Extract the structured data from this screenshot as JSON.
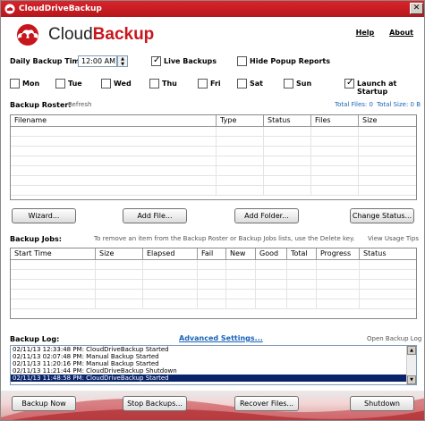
{
  "window": {
    "title": "CloudDriveBackup",
    "close_glyph": "✕"
  },
  "logo": {
    "prefix": "Cloud",
    "suffix": "Backup",
    "icon": "cloud-logo-icon"
  },
  "top_links": {
    "help": "Help",
    "about": "About"
  },
  "schedule": {
    "daily_label": "Daily Backup Time:",
    "time_value": "12:00 AM",
    "live_backups": {
      "label": "Live Backups",
      "checked": true
    },
    "hide_popup": {
      "label": "Hide Popup Reports",
      "checked": false
    },
    "launch_startup": {
      "label": "Launch at Startup",
      "checked": true
    },
    "days": [
      {
        "label": "Mon",
        "checked": false
      },
      {
        "label": "Tue",
        "checked": false
      },
      {
        "label": "Wed",
        "checked": false
      },
      {
        "label": "Thu",
        "checked": false
      },
      {
        "label": "Fri",
        "checked": false
      },
      {
        "label": "Sat",
        "checked": false
      },
      {
        "label": "Sun",
        "checked": false
      }
    ]
  },
  "roster": {
    "label": "Backup Roster:",
    "refresh": "Refresh",
    "total_files": "Total Files: 0",
    "total_size": "Total Size: 0 B",
    "columns": [
      "Filename",
      "Type",
      "Status",
      "Files",
      "Size"
    ],
    "buttons": {
      "wizard": "Wizard...",
      "add_file": "Add File...",
      "add_folder": "Add Folder...",
      "change_status": "Change Status..."
    }
  },
  "jobs": {
    "label": "Backup Jobs:",
    "hint": "To remove an item from the Backup Roster or Backup Jobs lists, use the Delete key.",
    "view_tips": "View Usage Tips",
    "columns": [
      "Start Time",
      "Size",
      "Elapsed",
      "Fail",
      "New",
      "Good",
      "Total",
      "Progress",
      "Status"
    ]
  },
  "log": {
    "label": "Backup Log:",
    "advanced": "Advanced Settings...",
    "open_log": "Open Backup Log",
    "lines": [
      "02/11/13 12:33:48 PM: CloudDriveBackup Started",
      "02/11/13 02:07:48 PM: Manual Backup Started",
      "02/11/13 11:20:16 PM: Manual Backup Started",
      "02/11/13 11:21:44 PM: CloudDriveBackup Shutdown",
      "02/11/13 11:48:58 PM: CloudDriveBackup Started"
    ],
    "selected_index": 4
  },
  "footer": {
    "backup_now": "Backup Now",
    "stop": "Stop Backups...",
    "recover": "Recover Files...",
    "shutdown": "Shutdown"
  },
  "colors": {
    "brand_red": "#c8161d",
    "link_blue": "#1a63b8",
    "selection": "#0a246a"
  }
}
